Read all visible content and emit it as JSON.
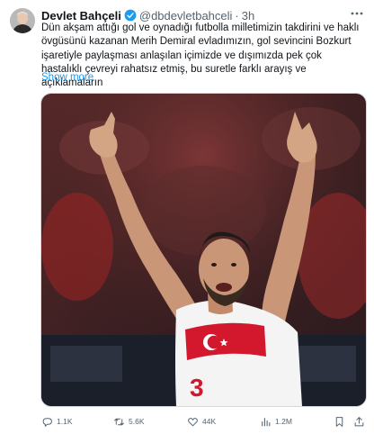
{
  "post": {
    "author_name": "Devlet Bahçeli",
    "handle": "@dbdevletbahceli",
    "separator": "·",
    "time": "3h",
    "text": "Dün akşam attığı gol ve oynadığı futbolla milletimizin takdirini ve haklı övgüsünü kazanan Merih Demiral evladımızın, gol sevincini Bozkurt işaretiyle paylaşması anlaşılan içimizde ve dışımızda pek çok hastalıklı çevreyi rahatsız etmiş, bu suretle farklı arayış ve açıklamaların",
    "show_more_label": "Show more",
    "more_icon": "more-horizontal-icon",
    "verified_icon": "verified-badge-icon",
    "jersey_number": "3"
  },
  "actions": {
    "replies": "1.1K",
    "reposts": "5.6K",
    "likes": "44K",
    "views": "1.2M"
  },
  "colors": {
    "accent": "#1d9bf0",
    "text_secondary": "#536471",
    "jersey_red": "#d3172d"
  }
}
